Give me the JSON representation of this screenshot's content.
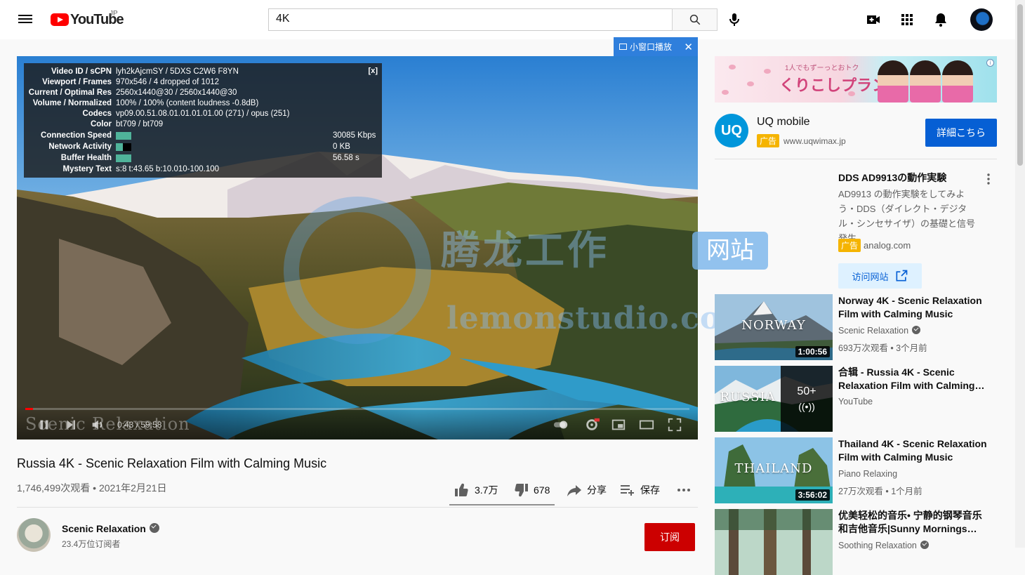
{
  "header": {
    "logo_text": "YouTube",
    "region": "JP",
    "search_value": "4K"
  },
  "player": {
    "miniplayer_label": "小窗口播放",
    "stats": {
      "close_label": "[x]",
      "video_id_label": "Video ID / sCPN",
      "video_id": "lyh2kAjcmSY / 5DXS C2W6 F8YN",
      "viewport_label": "Viewport / Frames",
      "viewport": "970x546 / 4 dropped of 1012",
      "res_label": "Current / Optimal Res",
      "res": "2560x1440@30 / 2560x1440@30",
      "volume_label": "Volume / Normalized",
      "volume": "100% / 100% (content loudness -0.8dB)",
      "codecs_label": "Codecs",
      "codecs": "vp09.00.51.08.01.01.01.01.00 (271) / opus (251)",
      "color_label": "Color",
      "color": "bt709 / bt709",
      "speed_label": "Connection Speed",
      "speed": "30085 Kbps",
      "network_label": "Network Activity",
      "network": "0 KB",
      "buffer_label": "Buffer Health",
      "buffer": "56.58 s",
      "mystery_label": "Mystery Text",
      "mystery": "s:8 t:43.65 b:10.010-100.100"
    },
    "time": "0:43 / 59:58",
    "progress_fraction": 0.012,
    "channel_watermark": "Scenic Relaxation",
    "watermark_cn": "腾龙工作",
    "watermark_en": "lemonstudio.com",
    "watermark_badge": "网站"
  },
  "video": {
    "title": "Russia 4K - Scenic Relaxation Film with Calming Music",
    "meta": "1,746,499次观看 • 2021年2月21日",
    "likes": "3.7万",
    "dislikes": "678",
    "share": "分享",
    "save": "保存"
  },
  "channel": {
    "name": "Scenic Relaxation",
    "subs": "23.4万位订阅者",
    "subscribe": "订阅"
  },
  "sidebar": {
    "banner_small": "1人でもずーっとおトク",
    "banner_big": "くりこしプラン",
    "uq": {
      "logo": "UQ",
      "name": "UQ mobile",
      "ad_tag": "广告",
      "url": "www.uqwimax.jp",
      "button": "詳細こちら"
    },
    "dds": {
      "title": "DDS AD9913の動作実験",
      "desc": "AD9913 の動作実験をしてみよう・DDS（ダイレクト・デジタル・シンセサイザ）の基礎と信号発生",
      "ad_tag": "广告",
      "site": "analog.com",
      "visit": "访问网站"
    },
    "recs": [
      {
        "thumb_text": "NORWAY",
        "duration": "1:00:56",
        "title": "Norway 4K - Scenic Relaxation Film with Calming Music",
        "channel": "Scenic Relaxation",
        "verified": true,
        "meta": "693万次观看 • 3个月前"
      },
      {
        "thumb_text": "RUSSIA",
        "playlist_count": "50+",
        "title": "合辑 - Russia 4K - Scenic Relaxation Film with Calming…",
        "channel": "YouTube",
        "verified": false,
        "meta": ""
      },
      {
        "thumb_text": "THAILAND",
        "duration": "3:56:02",
        "title": "Thailand 4K - Scenic Relaxation Film with Calming Music",
        "channel": "Piano Relaxing",
        "verified": false,
        "meta": "27万次观看 • 1个月前"
      },
      {
        "thumb_text": "",
        "duration": "",
        "title": "优美轻松的音乐• 宁静的钢琴音乐和吉他音乐|Sunny Mornings…",
        "channel": "Soothing Relaxation",
        "verified": true,
        "meta": ""
      }
    ]
  },
  "colors": {
    "brand_red": "#ff0000",
    "subscribe_red": "#cc0000",
    "link_blue": "#065fd4",
    "ad_yellow": "#f5b400"
  }
}
